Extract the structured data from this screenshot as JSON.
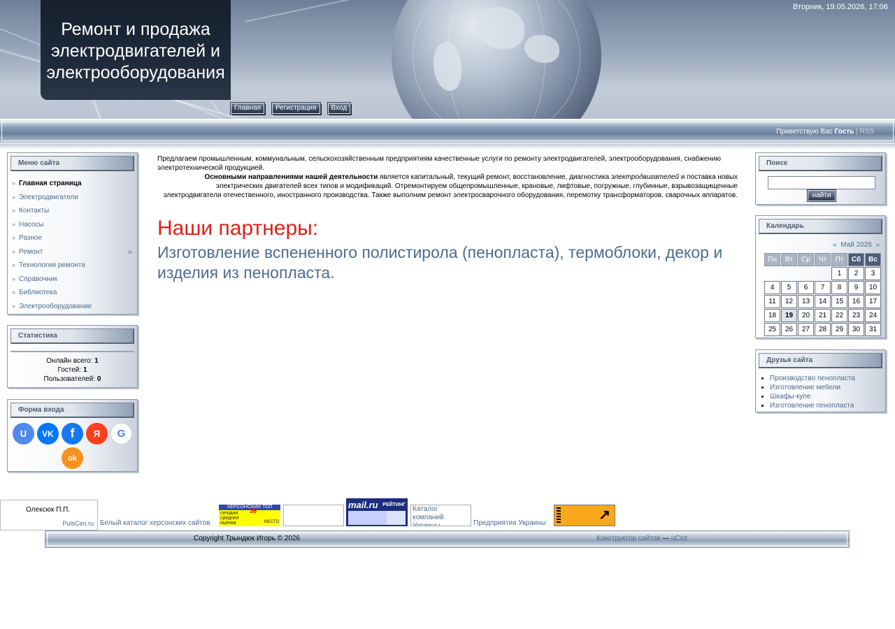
{
  "header": {
    "site_title": "Ремонт и продажа электродвигателей и электрооборудования",
    "datetime": "Вторник, 19.05.2026, 17:06",
    "nav": [
      "Главная",
      "Регистрация",
      "Вход"
    ]
  },
  "greeting": {
    "prefix": "Приветствую Вас",
    "user": "Гость",
    "separator": "|",
    "rss": "RSS"
  },
  "menu": {
    "title": "Меню сайта",
    "items": [
      {
        "label": "Главная страница",
        "active": true
      },
      {
        "label": "Электродвигатели"
      },
      {
        "label": "Контакты"
      },
      {
        "label": "Насосы"
      },
      {
        "label": "Разное"
      },
      {
        "label": "Ремонт",
        "has_submenu": true
      },
      {
        "label": "Технология ремонта"
      },
      {
        "label": "Справочник"
      },
      {
        "label": "Библиотека"
      },
      {
        "label": "Электрооборудование"
      }
    ]
  },
  "stats": {
    "title": "Статистика",
    "online_label": "Онлайн всего:",
    "online": "1",
    "guests_label": "Гостей:",
    "guests": "1",
    "users_label": "Пользователей:",
    "users": "0"
  },
  "login": {
    "title": "Форма входа",
    "providers": [
      {
        "name": "ucoz",
        "glyph": "U",
        "color": "#4f8be6"
      },
      {
        "name": "vk",
        "glyph": "VK",
        "color": "#0077ff"
      },
      {
        "name": "facebook",
        "glyph": "f",
        "color": "#1877f2"
      },
      {
        "name": "yandex",
        "glyph": "Я",
        "color": "#fc3f1d"
      },
      {
        "name": "google",
        "glyph": "G",
        "color": "#ffffff"
      },
      {
        "name": "odnoklassniki",
        "glyph": "ok",
        "color": "#f7931e"
      }
    ]
  },
  "content": {
    "intro": "Предлагаем промышленным, коммунальным, сельскохозяйственным предприятиям качественные услуги по ремонту электродвигателей,  электрооборудования, снабжению электротехнической продукцией.",
    "directions_bold": "Основными направлениями нашей деятельности",
    "directions_text1": " является капитальный, текущий ремонт, восстановление, диагностика ",
    "directions_italic": "электродвигателей",
    "directions_text2": " и поставка новых электрических двигателей всех типов и модификаций. Отремонтируем общепромышленные, крановые, лифтовые, погружные, глубинные, взрывозащищенные электродвигатели отечественного, иностранного производства. Также выполним ремонт электросварочного оборудования, перемотку трансформаторов, сварочных аппаратов.",
    "partners_title": "Наши партнеры:",
    "partners_link": "Изготовление вспененного полистирола (пенопласта), термоблоки, декор и изделия из пенопласта."
  },
  "search": {
    "title": "Поиск",
    "button": "найти",
    "value": ""
  },
  "calendar": {
    "title": "Календарь",
    "prev": "«",
    "month": "Май 2026",
    "next": "»",
    "weekdays": [
      "Пн",
      "Вт",
      "Ср",
      "Чт",
      "Пт",
      "Сб",
      "Вс"
    ],
    "today": 19,
    "weeks": [
      [
        "",
        "",
        "",
        "",
        "1",
        "2",
        "3"
      ],
      [
        "4",
        "5",
        "6",
        "7",
        "8",
        "9",
        "10"
      ],
      [
        "11",
        "12",
        "13",
        "14",
        "15",
        "16",
        "17"
      ],
      [
        "18",
        "19",
        "20",
        "21",
        "22",
        "23",
        "24"
      ],
      [
        "25",
        "26",
        "27",
        "28",
        "29",
        "30",
        "31"
      ]
    ]
  },
  "friends": {
    "title": "Друзья сайта",
    "links": [
      "Производство пенопласта",
      "Изготовление мебели",
      "Шкафы-купе",
      "Изготовление пенопласта"
    ]
  },
  "counters": {
    "name": "Олексюк П.П.",
    "pulscen": "PulsCen.ru",
    "white_catalog": "Белый каталог херсонских сайтов",
    "kherson_top": {
      "title": "ХЕРСОНСКИЙ ТОП",
      "line1": "сегодня",
      "line2": "среднее",
      "line3": "оценка",
      "place": "МЕСТО",
      "number": "38"
    },
    "mailru": {
      "logo": "mail.ru",
      "label": "РЕЙТИНГ"
    },
    "catalog_alt": "Каталог компаний Украины",
    "ukraine": "Предприятия Украины"
  },
  "footer": {
    "copyright": "Copyright Трындюк Игорь © 2026",
    "builder": "Конструктор сайтов",
    "dash": "—",
    "ucoz": "uCoz"
  },
  "colors": {
    "accent_link": "#4b6a8e",
    "partners_title": "#e02018"
  }
}
